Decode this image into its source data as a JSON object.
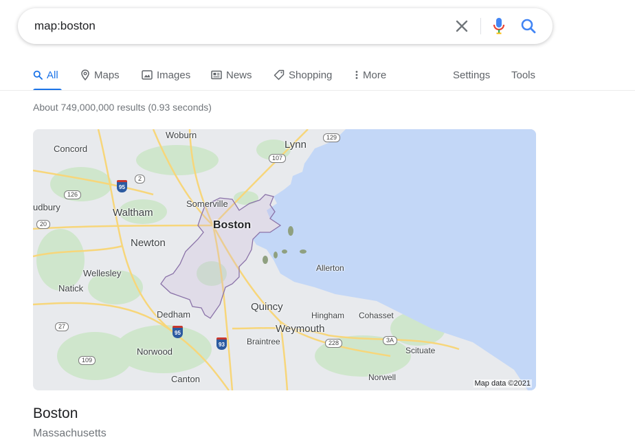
{
  "search": {
    "query": "map:boston",
    "clear_icon": "close-icon",
    "voice_icon": "mic-icon",
    "search_icon": "search-icon"
  },
  "tabs": [
    {
      "label": "All",
      "icon": "search-icon",
      "active": true
    },
    {
      "label": "Maps",
      "icon": "map-pin-icon"
    },
    {
      "label": "Images",
      "icon": "image-icon"
    },
    {
      "label": "News",
      "icon": "news-icon"
    },
    {
      "label": "Shopping",
      "icon": "tag-icon"
    },
    {
      "label": "More",
      "icon": "more-vert-icon"
    }
  ],
  "tools": {
    "settings": "Settings",
    "tools": "Tools"
  },
  "result_stats": "About 749,000,000 results (0.93 seconds)",
  "map": {
    "labels": {
      "woburn": "Woburn",
      "lynn": "Lynn",
      "concord": "Concord",
      "sudbury": "udbury",
      "waltham": "Waltham",
      "somerville": "Somerville",
      "boston": "Boston",
      "newton": "Newton",
      "allerton": "Allerton",
      "wellesley": "Wellesley",
      "natick": "Natick",
      "quincy": "Quincy",
      "dedham": "Dedham",
      "hingham": "Hingham",
      "cohasset": "Cohasset",
      "weymouth": "Weymouth",
      "braintree": "Braintree",
      "norwood": "Norwood",
      "scituate": "Scituate",
      "norwell": "Norwell",
      "canton": "Canton"
    },
    "routes": {
      "r129": "129",
      "r107": "107",
      "r2": "2",
      "r126": "126",
      "r20": "20",
      "r27": "27",
      "r228": "228",
      "r3a": "3A",
      "r109": "109",
      "i95_north": "95",
      "i95_south": "95",
      "i93": "93"
    },
    "attribution": "Map data ©2021",
    "colors": {
      "water": "#c3d7f7",
      "land": "#e8eaed",
      "park": "#cfe6cc",
      "road": "#f7d67a",
      "boundary": "#8a72a8"
    }
  },
  "place": {
    "title": "Boston",
    "subtitle": "Massachusetts"
  },
  "colors": {
    "accent": "#1a73e8",
    "text_secondary": "#70757a"
  }
}
